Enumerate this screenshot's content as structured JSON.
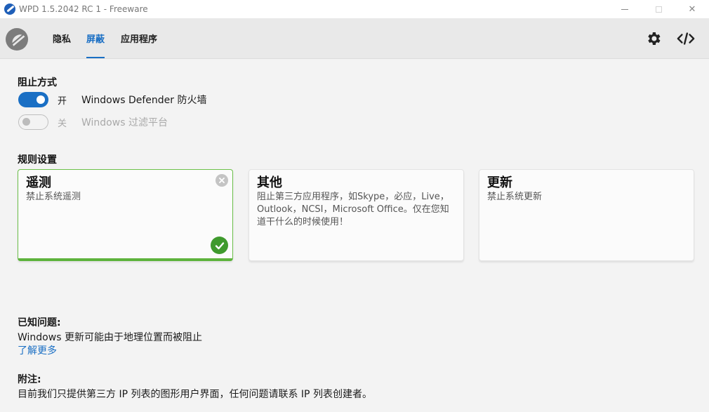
{
  "window": {
    "title": "WPD 1.5.2042 RC 1 - Freeware",
    "minimize_label": "",
    "maximize_label": "",
    "close_label": "✕"
  },
  "nav": {
    "tabs": [
      {
        "label": "隐私",
        "active": false
      },
      {
        "label": "屏蔽",
        "active": true
      },
      {
        "label": "应用程序",
        "active": false
      }
    ],
    "icons": [
      "gear-icon",
      "code-icon"
    ]
  },
  "blocking": {
    "title": "阻止方式",
    "options": [
      {
        "state": "开",
        "label": "Windows Defender 防火墙",
        "enabled": true
      },
      {
        "state": "关",
        "label": "Windows 过滤平台",
        "enabled": false
      }
    ]
  },
  "rules": {
    "title": "规则设置",
    "cards": [
      {
        "title": "遥测",
        "description": "禁止系统遥测",
        "selected": true
      },
      {
        "title": "其他",
        "description": "阻止第三方应用程序，如Skype，必应，Live，Outlook，NCSI，Microsoft Office。仅在您知道干什么的时候使用！",
        "selected": false
      },
      {
        "title": "更新",
        "description": "禁止系统更新",
        "selected": false
      }
    ]
  },
  "known_issues": {
    "title": "已知问题:",
    "text": "Windows 更新可能由于地理位置而被阻止",
    "link": "了解更多"
  },
  "notes": {
    "title": "附注:",
    "text": "目前我们只提供第三方 IP 列表的图形用户界面，任何问题请联系 IP 列表创建者。"
  },
  "colors": {
    "accent": "#1a6fc4",
    "selected_border": "#6cc04a",
    "check": "#3f9a2d"
  }
}
